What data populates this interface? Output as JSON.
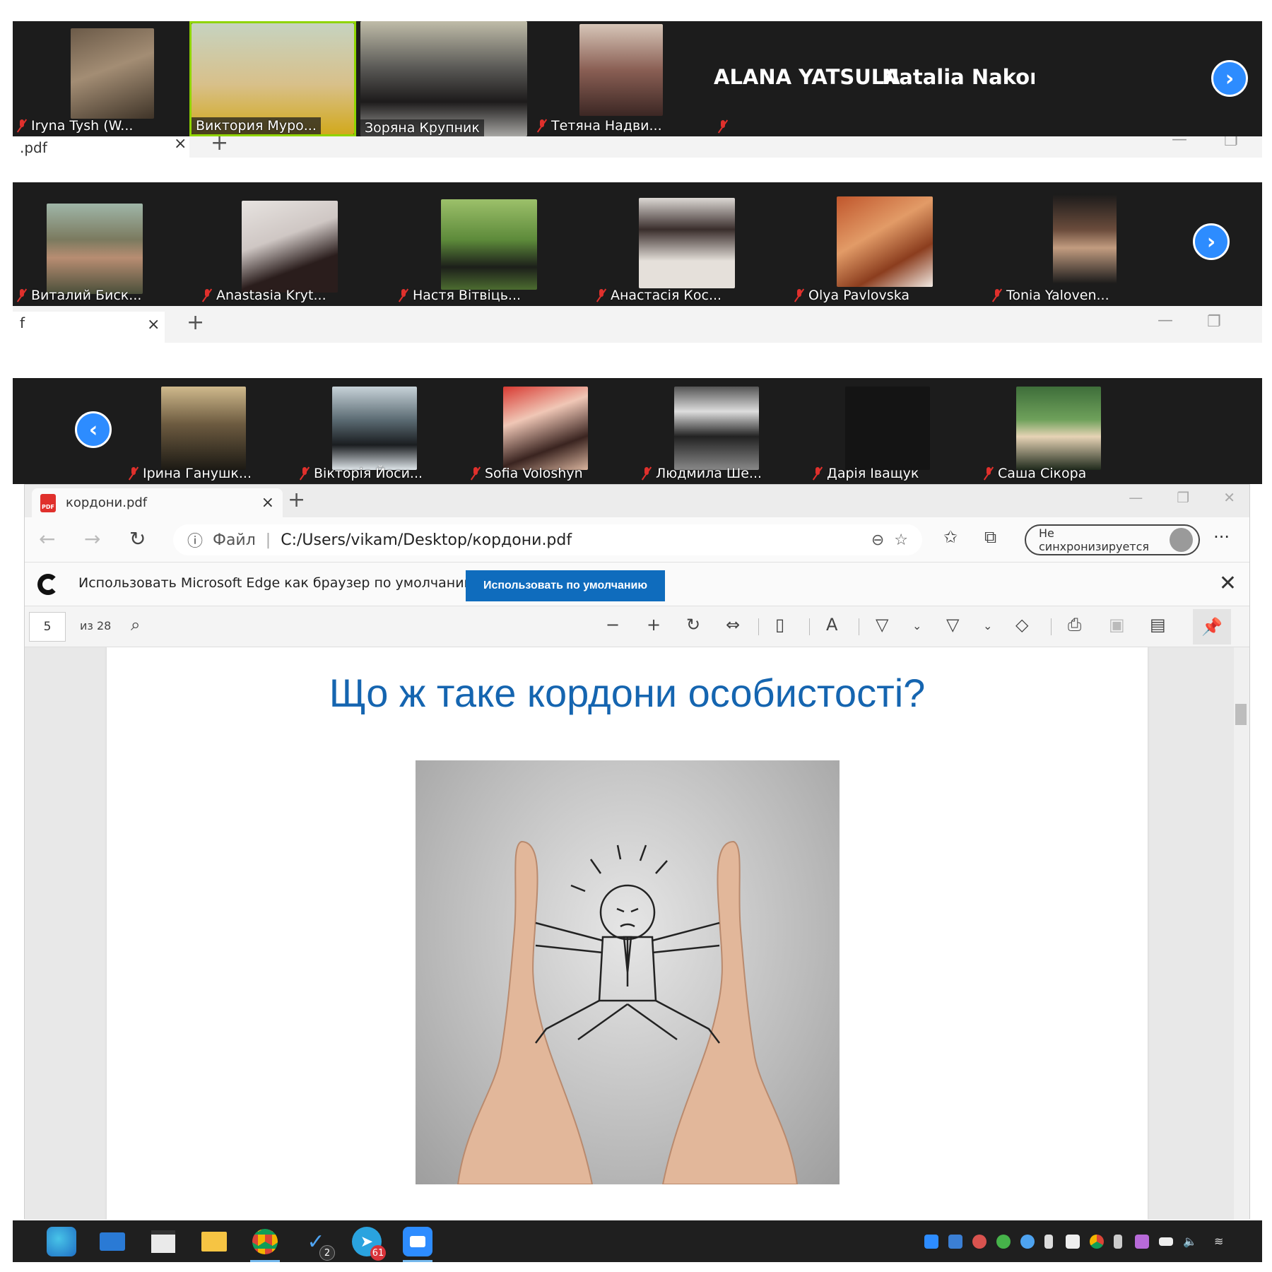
{
  "strip1": {
    "participants": [
      {
        "name": "Iryna Tysh (W..."
      },
      {
        "name": "Виктория Муро..."
      },
      {
        "name": "Зоряна Крупник"
      },
      {
        "name": "Тетяна Надви..."
      }
    ],
    "text_only": [
      "ALANA YATSULA",
      "Natalia  Nakone..."
    ],
    "next_button": "›"
  },
  "tab_strip1": {
    "tab": ".pdf",
    "close": "×",
    "new_tab": "+",
    "minimize": "—",
    "restore": "❐"
  },
  "strip2": {
    "participants": [
      {
        "name": "Виталий Биск..."
      },
      {
        "name": "Anastasia Kryt..."
      },
      {
        "name": "Настя Вітвіць..."
      },
      {
        "name": "Анастасія Кос..."
      },
      {
        "name": "Olya Pavlovska"
      },
      {
        "name": "Tonia Yaloven..."
      }
    ],
    "next_button": "›"
  },
  "tab_strip2": {
    "tab": "f",
    "close": "×",
    "new_tab": "+",
    "minimize": "—",
    "restore": "❐"
  },
  "strip3": {
    "prev_button": "‹",
    "participants": [
      {
        "name": "Ірина Ганушк..."
      },
      {
        "name": "Вікторія Йоси..."
      },
      {
        "name": "Sofia Voloshyn"
      },
      {
        "name": "Людмила Ше..."
      },
      {
        "name": "Дарія Іващук"
      },
      {
        "name": "Саша Сікора"
      }
    ]
  },
  "browser": {
    "tab_title": "кордони.pdf",
    "tab_close": "×",
    "new_tab": "+",
    "window_controls": [
      "—",
      "❐",
      "✕"
    ],
    "back": "←",
    "forward": "→",
    "refresh": "↻",
    "info_icon": "ⓘ",
    "scheme": "Файл",
    "url": "C:/Users/vikam/Desktop/кордони.pdf",
    "sync_label": "Не синхронизируется",
    "more": "···",
    "infobar_text": "Использовать Microsoft Edge как браузер по умолчанию?",
    "infobar_button": "Использовать по умолчанию",
    "infobar_close": "✕",
    "page_number": "5",
    "page_total": "из 28",
    "pdf_title": "Що ж таке кордони особистості?",
    "pdf_badge": "PDF"
  },
  "taskbar": {
    "todo_badge": "2",
    "telegram_badge": "61"
  },
  "colors": {
    "zoom_blue": "#2d8cff",
    "edge_button": "#0f6cbd",
    "slide_title": "#1565b0",
    "muted_red": "#e0302c"
  }
}
